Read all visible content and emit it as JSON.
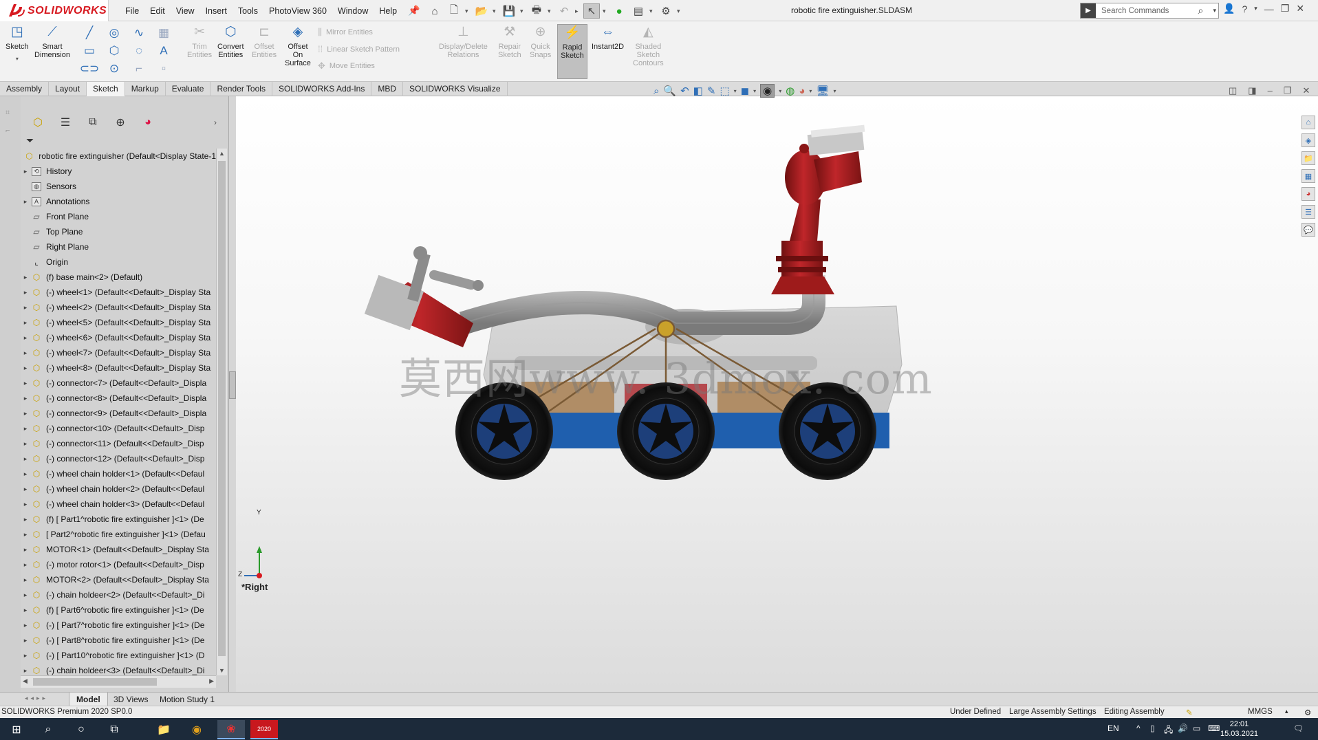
{
  "app": {
    "logo_text": "SOLIDWORKS",
    "window_title": "robotic fire extinguisher.SLDASM"
  },
  "menu": [
    "File",
    "Edit",
    "View",
    "Insert",
    "Tools",
    "PhotoView 360",
    "Window",
    "Help"
  ],
  "search": {
    "placeholder": "Search Commands"
  },
  "ribbon": {
    "sketch": "Sketch",
    "smart_dim": [
      "Smart",
      "Dimension"
    ],
    "trim": [
      "Trim",
      "Entities"
    ],
    "convert": [
      "Convert",
      "Entities"
    ],
    "offset_entities": [
      "Offset",
      "Entities"
    ],
    "offset_surface": [
      "Offset",
      "On",
      "Surface"
    ],
    "mirror": "Mirror Entities",
    "linear_pattern": "Linear Sketch Pattern",
    "move": "Move Entities",
    "display_delete": [
      "Display/Delete",
      "Relations"
    ],
    "repair": [
      "Repair",
      "Sketch"
    ],
    "quick_snaps": [
      "Quick",
      "Snaps"
    ],
    "rapid": [
      "Rapid",
      "Sketch"
    ],
    "instant2d": "Instant2D",
    "shaded": [
      "Shaded",
      "Sketch",
      "Contours"
    ]
  },
  "command_tabs": [
    "Assembly",
    "Layout",
    "Sketch",
    "Markup",
    "Evaluate",
    "Render Tools",
    "SOLIDWORKS Add-Ins",
    "MBD",
    "SOLIDWORKS Visualize"
  ],
  "command_tabs_active": "Sketch",
  "tree": {
    "root": "robotic fire extinguisher  (Default<Display State-1",
    "items": [
      {
        "label": "History",
        "icon": "history-icon",
        "exp": true
      },
      {
        "label": "Sensors",
        "icon": "sensors-icon",
        "exp": false
      },
      {
        "label": "Annotations",
        "icon": "annotations-icon",
        "exp": true
      },
      {
        "label": "Front Plane",
        "icon": "plane-icon",
        "exp": false
      },
      {
        "label": "Top Plane",
        "icon": "plane-icon",
        "exp": false
      },
      {
        "label": "Right Plane",
        "icon": "plane-icon",
        "exp": false
      },
      {
        "label": "Origin",
        "icon": "origin-icon",
        "exp": false
      },
      {
        "label": "(f) base main<2> (Default)",
        "icon": "part-icon",
        "exp": true
      },
      {
        "label": "(-) wheel<1> (Default<<Default>_Display Sta",
        "icon": "part-icon",
        "exp": true
      },
      {
        "label": "(-) wheel<2> (Default<<Default>_Display Sta",
        "icon": "part-icon",
        "exp": true
      },
      {
        "label": "(-) wheel<5> (Default<<Default>_Display Sta",
        "icon": "part-icon",
        "exp": true
      },
      {
        "label": "(-) wheel<6> (Default<<Default>_Display Sta",
        "icon": "part-icon",
        "exp": true
      },
      {
        "label": "(-) wheel<7> (Default<<Default>_Display Sta",
        "icon": "part-icon",
        "exp": true
      },
      {
        "label": "(-) wheel<8> (Default<<Default>_Display Sta",
        "icon": "part-icon",
        "exp": true
      },
      {
        "label": "(-) connector<7> (Default<<Default>_Displa",
        "icon": "part-icon",
        "exp": true
      },
      {
        "label": "(-) connector<8> (Default<<Default>_Displa",
        "icon": "part-icon",
        "exp": true
      },
      {
        "label": "(-) connector<9> (Default<<Default>_Displa",
        "icon": "part-icon",
        "exp": true
      },
      {
        "label": "(-) connector<10> (Default<<Default>_Disp",
        "icon": "part-icon",
        "exp": true
      },
      {
        "label": "(-) connector<11> (Default<<Default>_Disp",
        "icon": "part-icon",
        "exp": true
      },
      {
        "label": "(-) connector<12> (Default<<Default>_Disp",
        "icon": "part-icon",
        "exp": true
      },
      {
        "label": "(-) wheel chain holder<1> (Default<<Defaul",
        "icon": "part-icon",
        "exp": true
      },
      {
        "label": "(-) wheel chain holder<2> (Default<<Defaul",
        "icon": "part-icon",
        "exp": true
      },
      {
        "label": "(-) wheel chain holder<3> (Default<<Defaul",
        "icon": "part-icon",
        "exp": true
      },
      {
        "label": "(f) [ Part1^robotic fire extinguisher ]<1> (De",
        "icon": "part-icon",
        "exp": true
      },
      {
        "label": "[ Part2^robotic fire extinguisher ]<1> (Defau",
        "icon": "part-icon",
        "exp": true
      },
      {
        "label": "MOTOR<1> (Default<<Default>_Display Sta",
        "icon": "part-icon",
        "exp": true
      },
      {
        "label": "(-) motor rotor<1> (Default<<Default>_Disp",
        "icon": "part-icon",
        "exp": true
      },
      {
        "label": "MOTOR<2> (Default<<Default>_Display Sta",
        "icon": "part-icon",
        "exp": true
      },
      {
        "label": "(-) chain holdeer<2> (Default<<Default>_Di",
        "icon": "part-icon",
        "exp": true
      },
      {
        "label": "(f) [ Part6^robotic fire extinguisher ]<1> (De",
        "icon": "part-icon",
        "exp": true
      },
      {
        "label": "(-) [ Part7^robotic fire extinguisher ]<1> (De",
        "icon": "part-icon",
        "exp": true
      },
      {
        "label": "(-) [ Part8^robotic fire extinguisher ]<1> (De",
        "icon": "part-icon",
        "exp": true
      },
      {
        "label": "(-) [ Part10^robotic fire extinguisher ]<1> (D",
        "icon": "part-icon",
        "exp": true
      },
      {
        "label": "(-) chain holdeer<3> (Default<<Default>_Di",
        "icon": "part-icon",
        "exp": true
      }
    ]
  },
  "viewport": {
    "view_name": "*Right",
    "watermark": "莫西网www. 3dmox. com",
    "triad": {
      "y": "Y",
      "z": "Z"
    }
  },
  "bottom_tabs": [
    "Model",
    "3D Views",
    "Motion Study 1"
  ],
  "bottom_tabs_active": "Model",
  "status": {
    "product": "SOLIDWORKS Premium 2020 SP0.0",
    "defined": "Under Defined",
    "large": "Large Assembly Settings",
    "mode": "Editing Assembly",
    "units": "MMGS"
  },
  "taskbar": {
    "lang": "EN",
    "time": "22:01",
    "date": "15.03.2021",
    "sw_badge": "2020"
  },
  "colors": {
    "accent": "#d71920",
    "ribbon_icon": "#2f6fb7",
    "robot_red": "#9e1b1b",
    "robot_blue": "#1f5fae"
  }
}
